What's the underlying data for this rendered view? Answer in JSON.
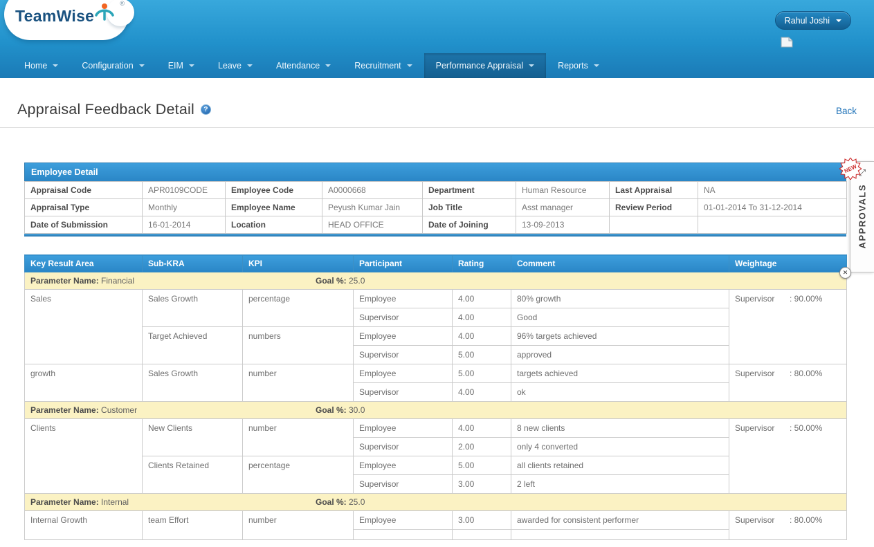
{
  "header": {
    "brand": "TeamWise",
    "registered": "®",
    "user": {
      "name": "Rahul Joshi"
    }
  },
  "nav": {
    "items": [
      {
        "label": "Home",
        "active": false
      },
      {
        "label": "Configuration",
        "active": false
      },
      {
        "label": "EIM",
        "active": false
      },
      {
        "label": "Leave",
        "active": false
      },
      {
        "label": "Attendance",
        "active": false
      },
      {
        "label": "Recruitment",
        "active": false
      },
      {
        "label": "Performance Appraisal",
        "active": true
      },
      {
        "label": "Reports",
        "active": false
      }
    ]
  },
  "page": {
    "title": "Appraisal Feedback Detail",
    "back": "Back"
  },
  "icons": {
    "help": "?",
    "expand": "⤢",
    "close": "✕"
  },
  "employee_detail": {
    "title": "Employee Detail",
    "rows": [
      [
        {
          "label": "Appraisal Code",
          "value": "APR0109CODE"
        },
        {
          "label": "Employee Code",
          "value": "A0000668"
        },
        {
          "label": "Department",
          "value": "Human Resource"
        },
        {
          "label": "Last Appraisal",
          "value": "NA"
        }
      ],
      [
        {
          "label": "Appraisal Type",
          "value": "Monthly"
        },
        {
          "label": "Employee Name",
          "value": "Peyush Kumar Jain"
        },
        {
          "label": "Job Title",
          "value": "Asst manager"
        },
        {
          "label": "Review Period",
          "value": "01-01-2014 To 31-12-2014"
        }
      ],
      [
        {
          "label": "Date of Submission",
          "value": "16-01-2014"
        },
        {
          "label": "Location",
          "value": "HEAD OFFICE"
        },
        {
          "label": "Date of Joining",
          "value": "13-09-2013"
        },
        {
          "label": "",
          "value": ""
        }
      ]
    ]
  },
  "kra_table": {
    "columns": [
      "Key Result Area",
      "Sub-KRA",
      "KPI",
      "Participant",
      "Rating",
      "Comment",
      "Weightage"
    ],
    "parameter_label": "Parameter Name:",
    "goal_label": "Goal %:",
    "groups": [
      {
        "parameter": "Financial",
        "goal": "25.0",
        "kras": [
          {
            "name": "Sales",
            "weightage": {
              "label": "Supervisor",
              "value": ": 90.00%"
            },
            "subs": [
              {
                "sub_kra": "Sales Growth",
                "kpi": "percentage",
                "entries": [
                  {
                    "participant": "Employee",
                    "rating": "4.00",
                    "comment": "80% growth"
                  },
                  {
                    "participant": "Supervisor",
                    "rating": "4.00",
                    "comment": "Good"
                  }
                ]
              },
              {
                "sub_kra": "Target Achieved",
                "kpi": "numbers",
                "entries": [
                  {
                    "participant": "Employee",
                    "rating": "4.00",
                    "comment": "96% targets achieved"
                  },
                  {
                    "participant": "Supervisor",
                    "rating": "5.00",
                    "comment": "approved"
                  }
                ]
              }
            ]
          },
          {
            "name": "growth",
            "weightage": {
              "label": "Supervisor",
              "value": ": 80.00%"
            },
            "subs": [
              {
                "sub_kra": "Sales Growth",
                "kpi": "number",
                "entries": [
                  {
                    "participant": "Employee",
                    "rating": "5.00",
                    "comment": "targets achieved"
                  },
                  {
                    "participant": "Supervisor",
                    "rating": "4.00",
                    "comment": "ok"
                  }
                ]
              }
            ]
          }
        ]
      },
      {
        "parameter": "Customer",
        "goal": "30.0",
        "kras": [
          {
            "name": "Clients",
            "weightage": {
              "label": "Supervisor",
              "value": ": 50.00%"
            },
            "subs": [
              {
                "sub_kra": "New Clients",
                "kpi": "number",
                "entries": [
                  {
                    "participant": "Employee",
                    "rating": "4.00",
                    "comment": "8 new clients"
                  },
                  {
                    "participant": "Supervisor",
                    "rating": "2.00",
                    "comment": "only 4 converted"
                  }
                ]
              },
              {
                "sub_kra": "Clients Retained",
                "kpi": "percentage",
                "entries": [
                  {
                    "participant": "Employee",
                    "rating": "5.00",
                    "comment": "all clients retained"
                  },
                  {
                    "participant": "Supervisor",
                    "rating": "3.00",
                    "comment": "2 left"
                  }
                ]
              }
            ]
          }
        ]
      },
      {
        "parameter": "Internal",
        "goal": "25.0",
        "kras": [
          {
            "name": "Internal Growth",
            "weightage": {
              "label": "Supervisor",
              "value": ": 80.00%"
            },
            "subs": [
              {
                "sub_kra": "team Effort",
                "kpi": "number",
                "entries": [
                  {
                    "participant": "Employee",
                    "rating": "3.00",
                    "comment": "awarded for consistent performer"
                  },
                  {
                    "participant": "",
                    "rating": "",
                    "comment": ""
                  }
                ]
              }
            ]
          }
        ]
      }
    ]
  },
  "approvals": {
    "label": "APPROVALS",
    "badge": "NEW"
  }
}
